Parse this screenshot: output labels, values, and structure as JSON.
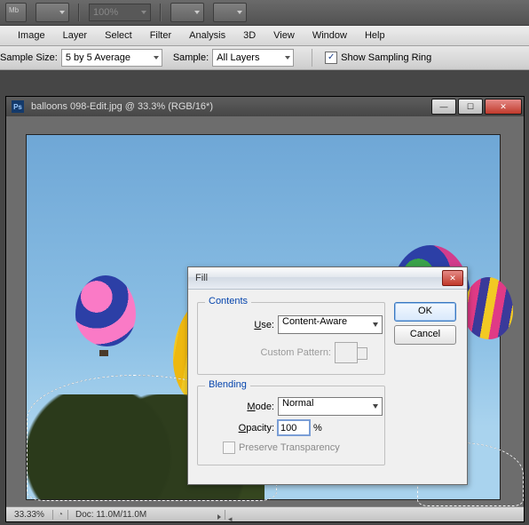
{
  "toolbar": {
    "zoom": "100%"
  },
  "menubar": {
    "items": [
      "Image",
      "Layer",
      "Select",
      "Filter",
      "Analysis",
      "3D",
      "View",
      "Window",
      "Help"
    ]
  },
  "options": {
    "sample_size_label": "Sample Size:",
    "sample_size_value": "5 by 5 Average",
    "sample_label": "Sample:",
    "sample_value": "All Layers",
    "show_ring_label": "Show Sampling Ring",
    "show_ring_checked": "✓"
  },
  "doc": {
    "title": "balloons 098-Edit.jpg @ 33.3% (RGB/16*)",
    "status_zoom": "33.33%",
    "status_doc": "Doc: 11.0M/11.0M"
  },
  "dialog": {
    "title": "Fill",
    "contents_legend": "Contents",
    "use_label": "Use:",
    "use_value": "Content-Aware",
    "custom_pattern_label": "Custom Pattern:",
    "blending_legend": "Blending",
    "mode_label": "Mode:",
    "mode_value": "Normal",
    "opacity_label": "Opacity:",
    "opacity_value": "100",
    "opacity_unit": "%",
    "preserve_label": "Preserve Transparency",
    "ok": "OK",
    "cancel": "Cancel"
  }
}
